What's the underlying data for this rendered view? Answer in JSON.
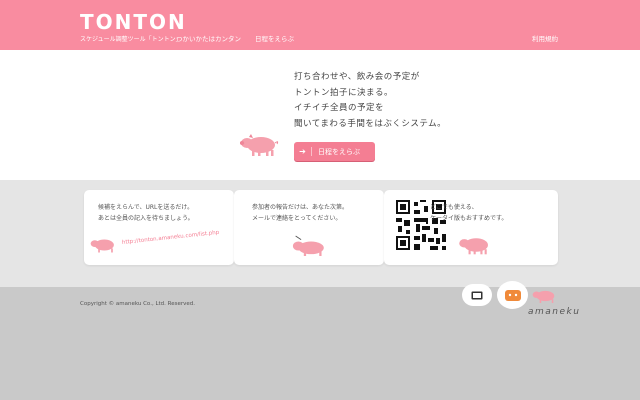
{
  "header": {
    "logo": "TONTON",
    "logo_sub": "スケジュール調整ツール「トントン」",
    "nav": [
      {
        "label": "つかいかたはカンタン"
      },
      {
        "label": "日程をえらぶ"
      }
    ],
    "terms": "利用規約"
  },
  "hero": {
    "tagline": [
      "打ち合わせや、飲み会の予定が",
      "トントン拍子に決まる。",
      "イチイチ全員の予定を",
      "聞いてまわる手間をはぶくシステム。"
    ],
    "cta_label": "日程をえらぶ",
    "cta_arrow": "➔"
  },
  "features": [
    {
      "lines": [
        "候補をえらんで、URLを送るだけ。",
        "あとは全員の記入を待ちましょう。"
      ],
      "url": "http://tonton.amaneku.com/list.php"
    },
    {
      "lines": [
        "参加者の報告だけは、あなた次第。",
        "メールで連絡をとってください。"
      ]
    },
    {
      "lines": [
        "どこでも使える、",
        "ケータイ版もおすすめです。"
      ]
    }
  ],
  "footer": {
    "copyright": "Copyright © amaneku Co., Ltd. Reserved.",
    "brand": "amaneku"
  },
  "colors": {
    "brand_pink": "#f98ca0",
    "button_pink": "#f47e93",
    "pig": "#f5a0ad"
  }
}
